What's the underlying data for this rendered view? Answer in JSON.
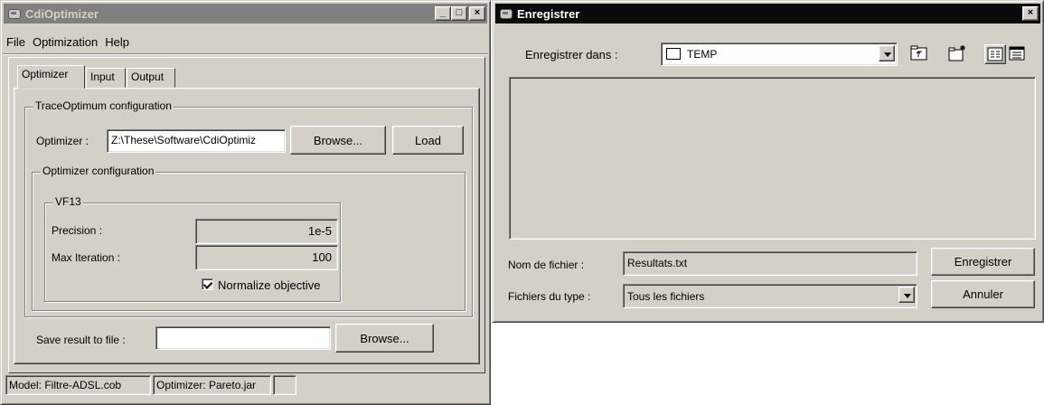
{
  "left_window": {
    "title": "CdiOptimizer",
    "menu": [
      "File",
      "Optimization",
      "Help"
    ],
    "tabs": [
      "Optimizer",
      "Input",
      "Output"
    ],
    "trace_group_title": "TraceOptimum configuration",
    "optimizer_label": "Optimizer :",
    "optimizer_path": "Z:\\These\\Software\\CdiOptimiz",
    "browse_label": "Browse...",
    "load_label": "Load",
    "optimizer_config_title": "Optimizer configuration",
    "vf13_title": "VF13",
    "precision_label": "Precision :",
    "precision_value": "1e-5",
    "max_iter_label": "Max Iteration :",
    "max_iter_value": "100",
    "normalize_label": "Normalize objective",
    "normalize_checked": true,
    "save_label": "Save result to file :",
    "save_value": "",
    "save_browse_label": "Browse...",
    "status": [
      "Model: Filtre-ADSL.cob",
      "Optimizer: Pareto.jar",
      ""
    ]
  },
  "right_window": {
    "title": "Enregistrer",
    "save_in_label": "Enregistrer dans :",
    "save_in_value": "TEMP",
    "filename_label": "Nom de fichier :",
    "filename_value": "Resultats.txt",
    "filetype_label": "Fichiers du type :",
    "filetype_value": "Tous les fichiers",
    "save_button": "Enregistrer",
    "cancel_button": "Annuler",
    "icons": [
      "folder-icon",
      "up-folder-icon",
      "new-folder-icon",
      "list-view-icon",
      "details-view-icon"
    ]
  },
  "title_buttons": [
    "_",
    "□",
    "×"
  ]
}
